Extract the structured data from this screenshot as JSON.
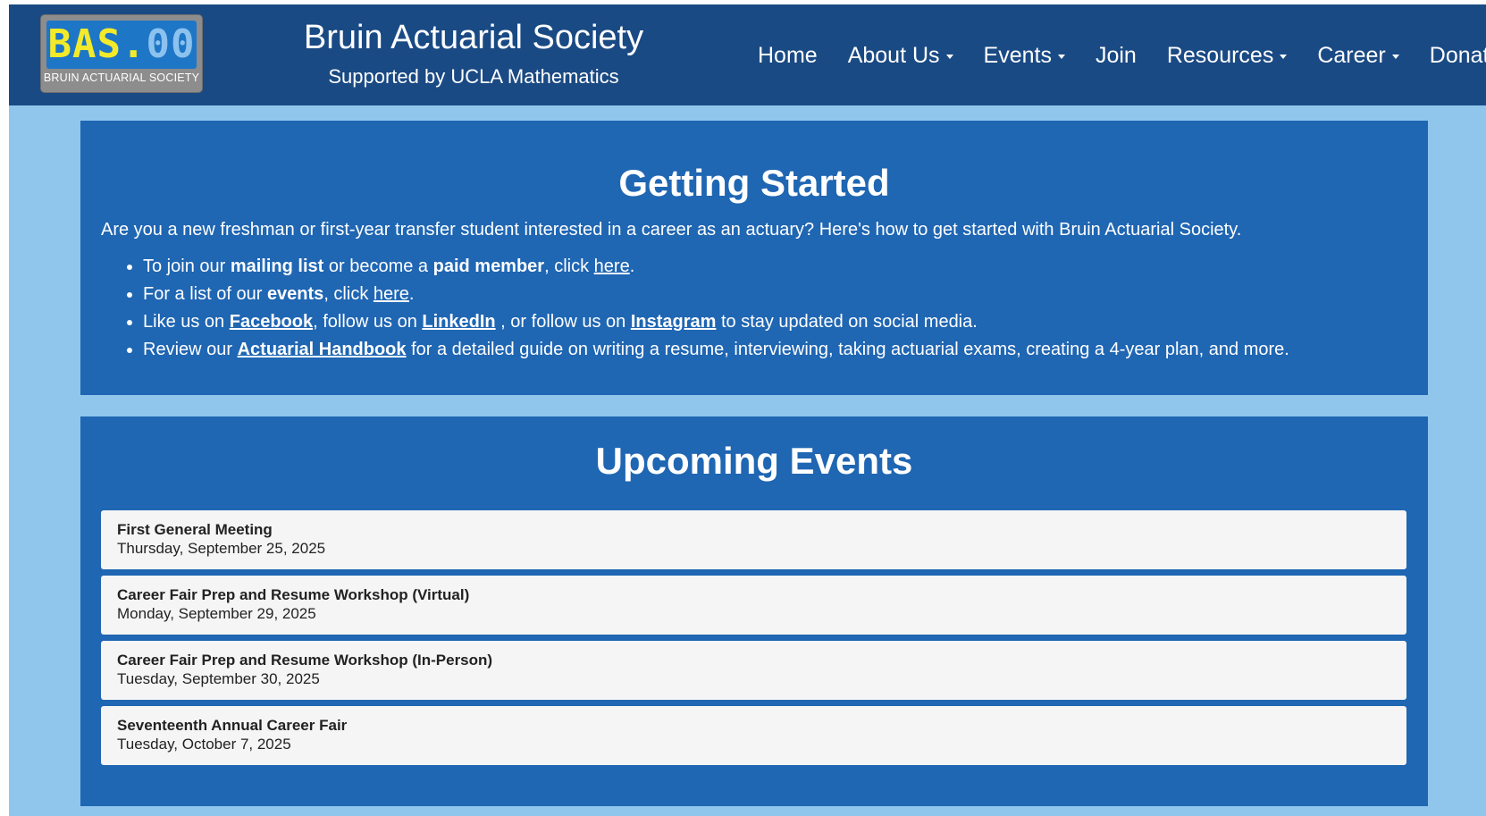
{
  "logo": {
    "digits_lit": "BAS.",
    "digits_dim": "00",
    "caption": "BRUIN ACTUARIAL SOCIETY"
  },
  "header": {
    "title": "Bruin Actuarial Society",
    "subtitle": "Supported by UCLA Mathematics"
  },
  "nav": {
    "items": [
      {
        "label": "Home",
        "dropdown": false
      },
      {
        "label": "About Us",
        "dropdown": true
      },
      {
        "label": "Events",
        "dropdown": true
      },
      {
        "label": "Join",
        "dropdown": false
      },
      {
        "label": "Resources",
        "dropdown": true
      },
      {
        "label": "Career",
        "dropdown": true
      },
      {
        "label": "Donate",
        "dropdown": false
      }
    ]
  },
  "getting_started": {
    "heading": "Getting Started",
    "intro": "Are you a new freshman or first-year transfer student interested in a career as an actuary? Here's how to get started with Bruin Actuarial Society.",
    "bullet1": {
      "t1": "To join our ",
      "b1": "mailing list",
      "t2": " or become a ",
      "b2": "paid member",
      "t3": ", click ",
      "link": "here",
      "t4": "."
    },
    "bullet2": {
      "t1": "For a list of our ",
      "b1": "events",
      "t2": ", click ",
      "link": "here",
      "t3": "."
    },
    "bullet3": {
      "t1": "Like us on ",
      "link1": "Facebook",
      "t2": ", follow us on ",
      "link2": "LinkedIn",
      "t3": " , or follow us on ",
      "link3": "Instagram",
      "t4": " to stay updated on social media."
    },
    "bullet4": {
      "t1": "Review our ",
      "link": "Actuarial Handbook",
      "t2": " for a detailed guide on writing a resume, interviewing, taking actuarial exams, creating a 4-year plan, and more."
    }
  },
  "upcoming_events": {
    "heading": "Upcoming Events",
    "events": [
      {
        "name": "First General Meeting",
        "date": "Thursday, September 25, 2025"
      },
      {
        "name": "Career Fair Prep and Resume Workshop (Virtual)",
        "date": "Monday, September 29, 2025"
      },
      {
        "name": "Career Fair Prep and Resume Workshop (In-Person)",
        "date": "Tuesday, September 30, 2025"
      },
      {
        "name": "Seventeenth Annual Career Fair",
        "date": "Tuesday, October 7, 2025"
      }
    ]
  },
  "colors": {
    "navbar": "#1a4a84",
    "page_background": "#91c6ec",
    "panel": "#1f66b3",
    "event_card": "#f5f5f5",
    "logo_lit_digits": "#f2ea2a"
  }
}
